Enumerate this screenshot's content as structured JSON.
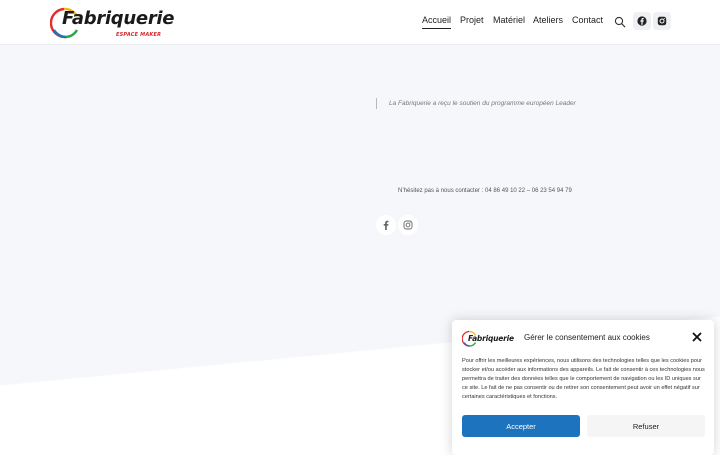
{
  "brand": {
    "name": "Fabriquerie",
    "tagline": "ESPACE MAKER"
  },
  "nav": {
    "items": [
      {
        "label": "Accueil",
        "active": true
      },
      {
        "label": "Projet",
        "active": false
      },
      {
        "label": "Matériel",
        "active": false
      },
      {
        "label": "Ateliers",
        "active": false
      },
      {
        "label": "Contact",
        "active": false
      }
    ]
  },
  "hero": {
    "quote": "La Fabriquerie a reçu le soutien du programme européen Leader",
    "contact": "N’hésitez pas à nous contacter : 04 86 49 10 22 – 06 23 54 94 79"
  },
  "cookie": {
    "brand": "Fabriquerie",
    "title": "Gérer le consentement aux cookies",
    "body": "Pour offrir les meilleures expériences, nous utilisons des technologies telles que les cookies pour stocker et/ou accéder aux informations des appareils. Le fait de consentir à ces technologies nous permettra de traiter des données telles que le comportement de navigation ou les ID uniques sur ce site. Le fait de ne pas consentir ou de retirer son consentement peut avoir un effet négatif sur certaines caractéristiques et fonctions.",
    "accept_label": "Accepter",
    "refuse_label": "Refuser"
  },
  "icons": [
    "search-icon",
    "facebook-icon",
    "instagram-icon",
    "close-icon"
  ],
  "colors": {
    "accent": "#1e73be",
    "hero_background": "#f6f7fa",
    "brand_red": "#d6262c"
  }
}
